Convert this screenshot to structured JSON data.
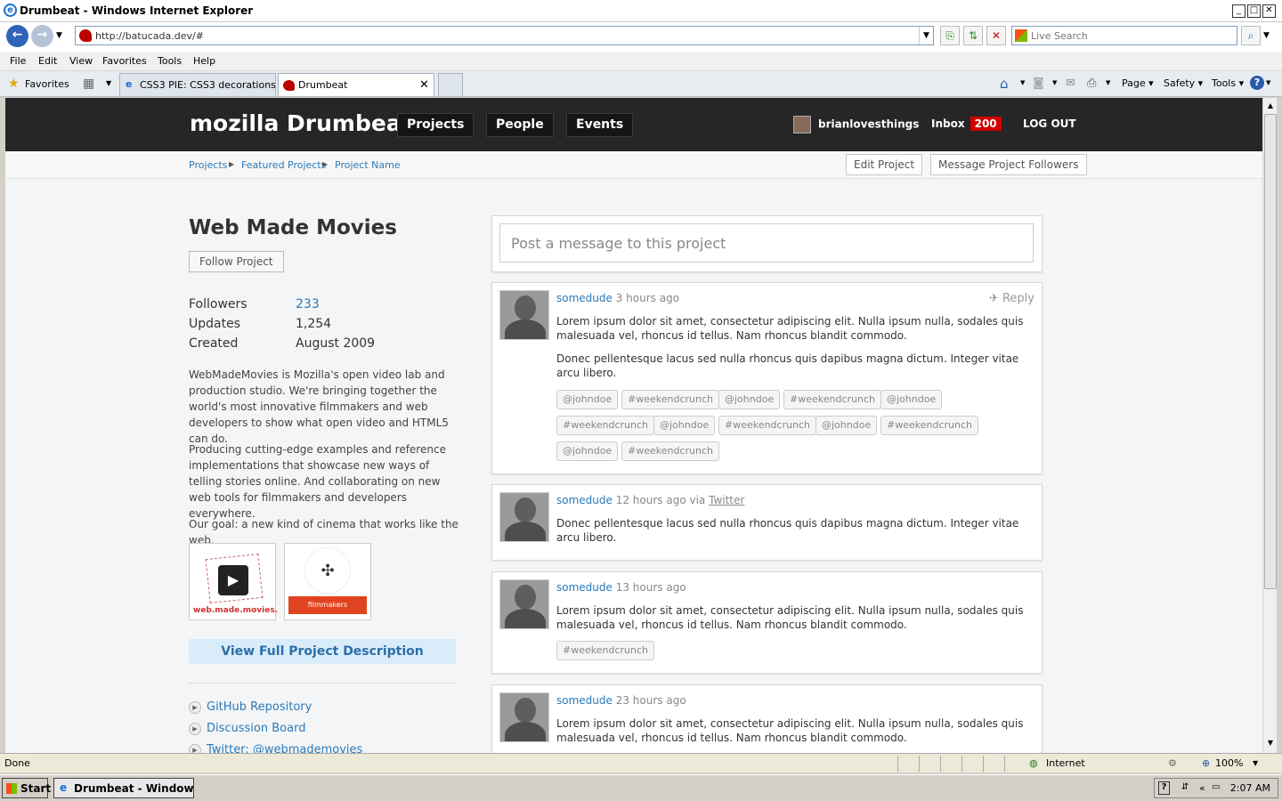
{
  "window": {
    "title": "Drumbeat - Windows Internet Explorer"
  },
  "address": {
    "url": "http://batucada.dev/#",
    "search_placeholder": "Live Search"
  },
  "menu": [
    "File",
    "Edit",
    "View",
    "Favorites",
    "Tools",
    "Help"
  ],
  "favorites_label": "Favorites",
  "tabs": [
    {
      "label": "CSS3 PIE: CSS3 decorations ..."
    },
    {
      "label": "Drumbeat"
    }
  ],
  "commands": {
    "page": "Page",
    "safety": "Safety",
    "tools": "Tools"
  },
  "site": {
    "logo": "mozilla Drumbeat",
    "nav": [
      "Projects",
      "People",
      "Events"
    ],
    "username": "brianlovesthings",
    "inbox_label": "Inbox",
    "inbox_count": "200",
    "logout": "LOG OUT"
  },
  "breadcrumb": [
    "Projects",
    "Featured Projects",
    "Project Name"
  ],
  "subbar_buttons": {
    "edit": "Edit Project",
    "message": "Message Project Followers"
  },
  "project": {
    "title": "Web Made Movies",
    "follow_label": "Follow Project",
    "stats": [
      {
        "label": "Followers",
        "value": "233"
      },
      {
        "label": "Updates",
        "value": "1,254"
      },
      {
        "label": "Created",
        "value": "August 2009"
      }
    ],
    "descriptions": [
      "WebMadeMovies is Mozilla's open video lab and production studio. We're bringing together the world's most innovative filmmakers and web developers to show what open video and HTML5 can do.",
      "Producing cutting-edge examples and reference implementations that showcase new ways of telling stories online. And collaborating on new web tools for filmmakers and developers everywhere.",
      "Our goal: a new kind of cinema that works like the web."
    ],
    "thumb1_caption": "web.made.movies.",
    "thumb2_caption": "filmmakers",
    "view_full": "View Full Project Description",
    "links": [
      "GitHub Repository",
      "Discussion Board",
      "Twitter: @webmademovies"
    ]
  },
  "post_placeholder": "Post a message to this project",
  "reply_label": "Reply",
  "feed": [
    {
      "user": "somedude",
      "time": "3 hours ago",
      "via": "",
      "paragraphs": [
        "Lorem ipsum dolor sit amet, consectetur adipiscing elit. Nulla ipsum nulla, sodales quis malesuada vel, rhoncus id tellus. Nam rhoncus blandit commodo.",
        "Donec pellentesque lacus sed nulla rhoncus quis dapibus magna dictum. Integer vitae arcu libero."
      ],
      "tags": [
        "@johndoe",
        "#weekendcrunch",
        "@johndoe",
        "#weekendcrunch",
        "@johndoe",
        "#weekendcrunch",
        "@johndoe",
        "#weekendcrunch",
        "@johndoe",
        "#weekendcrunch",
        "@johndoe",
        "#weekendcrunch"
      ]
    },
    {
      "user": "somedude",
      "time": "12 hours ago via",
      "via": "Twitter",
      "paragraphs": [
        "Donec pellentesque lacus sed nulla rhoncus quis dapibus magna dictum. Integer vitae arcu libero."
      ],
      "tags": []
    },
    {
      "user": "somedude",
      "time": "13 hours ago",
      "via": "",
      "paragraphs": [
        "Lorem ipsum dolor sit amet, consectetur adipiscing elit. Nulla ipsum nulla, sodales quis malesuada vel, rhoncus id tellus. Nam rhoncus blandit commodo."
      ],
      "tags": [
        "#weekendcrunch"
      ]
    },
    {
      "user": "somedude",
      "time": "23 hours ago",
      "via": "",
      "paragraphs": [
        "Lorem ipsum dolor sit amet, consectetur adipiscing elit. Nulla ipsum nulla, sodales quis malesuada vel, rhoncus id tellus. Nam rhoncus blandit commodo."
      ],
      "tags": []
    }
  ],
  "status": {
    "text": "Done",
    "zone": "Internet",
    "zoom": "100%"
  },
  "taskbar": {
    "start": "Start",
    "task": "Drumbeat - Windows ...",
    "clock": "2:07 AM"
  }
}
